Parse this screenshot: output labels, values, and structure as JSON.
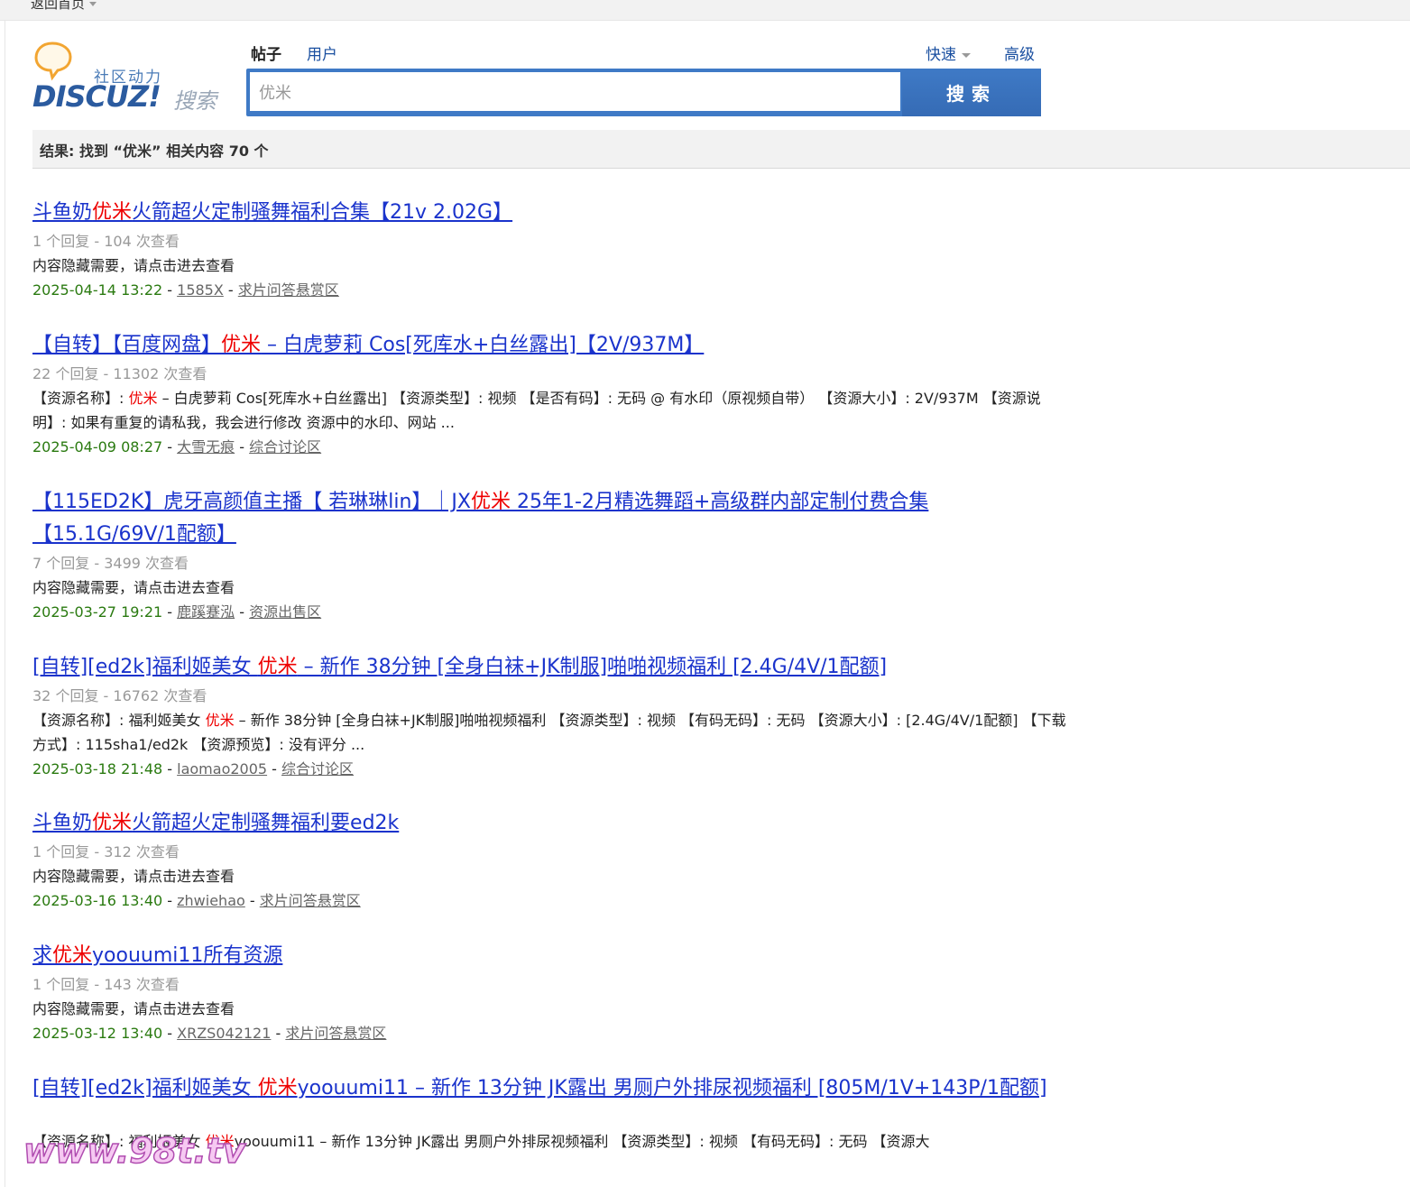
{
  "topbar": {
    "home_label": "返回首页"
  },
  "logo": {
    "tagline": "社区动力",
    "brand": "DISCUZ!",
    "suffix": "搜索"
  },
  "search": {
    "tabs": [
      {
        "label": "帖子"
      },
      {
        "label": "用户"
      }
    ],
    "quick_label": "快速",
    "advanced_label": "高级",
    "query": "优米",
    "button_label": "搜索"
  },
  "summary": "结果: 找到 “优米” 相关内容 70 个",
  "results": [
    {
      "title_pre": "斗鱼奶",
      "title_hl": "优米",
      "title_post": "火箭超火定制骚舞福利合集【21v 2.02G】",
      "stats": "1 个回复 - 104 次查看",
      "snip_pre": "内容隐藏需要，请点击进去查看",
      "snip_hl": "",
      "snip_post": "",
      "date": "2025-04-14 13:22",
      "author": "1585X",
      "forum": "求片问答悬赏区"
    },
    {
      "title_pre": "【自转】【百度网盘】",
      "title_hl": "优米",
      "title_post": " – 白虎萝莉 Cos[死库水+白丝露出]【2V/937M】",
      "stats": "22 个回复 - 11302 次查看",
      "snip_pre": "【资源名称】: ",
      "snip_hl": "优米",
      "snip_post": " – 白虎萝莉 Cos[死库水+白丝露出] 【资源类型】: 视频 【是否有码】: 无码 @ 有水印（原视频自带） 【资源大小】: 2V/937M 【资源说明】: 如果有重复的请私我，我会进行修改 资源中的水印、网站 ...",
      "date": "2025-04-09 08:27",
      "author": "大雪无痕",
      "forum": "综合讨论区"
    },
    {
      "title_pre": "【115ED2K】虎牙高颜值主播【 若琳琳lin】｜JX",
      "title_hl": "优米",
      "title_post": " 25年1-2月精选舞蹈+高级群内部定制付费合集【15.1G/69V/1配额】",
      "stats": "7 个回复 - 3499 次查看",
      "snip_pre": "内容隐藏需要，请点击进去查看",
      "snip_hl": "",
      "snip_post": "",
      "date": "2025-03-27 19:21",
      "author": "鹿蹊蹇泓",
      "forum": "资源出售区"
    },
    {
      "title_pre": "[自转][ed2k]福利姬美女 ",
      "title_hl": "优米",
      "title_post": " – 新作 38分钟 [全身白袜+JK制服]啪啪视频福利 [2.4G/4V/1配额]",
      "stats": "32 个回复 - 16762 次查看",
      "snip_pre": "【资源名称】: 福利姬美女 ",
      "snip_hl": "优米",
      "snip_post": " – 新作 38分钟 [全身白袜+JK制服]啪啪视频福利 【资源类型】: 视频 【有码无码】: 无码 【资源大小】: [2.4G/4V/1配额] 【下载方式】: 115sha1/ed2k 【资源预览】: 没有评分 ...",
      "date": "2025-03-18 21:48",
      "author": "laomao2005",
      "forum": "综合讨论区"
    },
    {
      "title_pre": "斗鱼奶",
      "title_hl": "优米",
      "title_post": "火箭超火定制骚舞福利要ed2k",
      "stats": "1 个回复 - 312 次查看",
      "snip_pre": "内容隐藏需要，请点击进去查看",
      "snip_hl": "",
      "snip_post": "",
      "date": "2025-03-16 13:40",
      "author": "zhwiehao",
      "forum": "求片问答悬赏区"
    },
    {
      "title_pre": "求",
      "title_hl": "优米",
      "title_post": "yoouumi11所有资源",
      "stats": "1 个回复 - 143 次查看",
      "snip_pre": "内容隐藏需要，请点击进去查看",
      "snip_hl": "",
      "snip_post": "",
      "date": "2025-03-12 13:40",
      "author": "XRZS042121",
      "forum": "求片问答悬赏区"
    },
    {
      "title_pre": "[自转][ed2k]福利姬美女 ",
      "title_hl": "优米",
      "title_post": "yoouumi11 – 新作 13分钟 JK露出 男厕户外排尿视频福利 [805M/1V+143P/1配额]",
      "stats": "",
      "snip_pre": "【资源名称】: 福利姬美女 ",
      "snip_hl": "优米",
      "snip_post": "yoouumi11 – 新作 13分钟 JK露出 男厕户外排尿视频福利 【资源类型】: 视频 【有码无码】: 无码 【资源大",
      "date": "",
      "author": "",
      "forum": ""
    }
  ],
  "watermark": "www.98t.tv",
  "colors": {
    "accent": "#3f7ac6",
    "link": "#1a33cc",
    "highlight": "#e00000",
    "date": "#2a7a10"
  }
}
